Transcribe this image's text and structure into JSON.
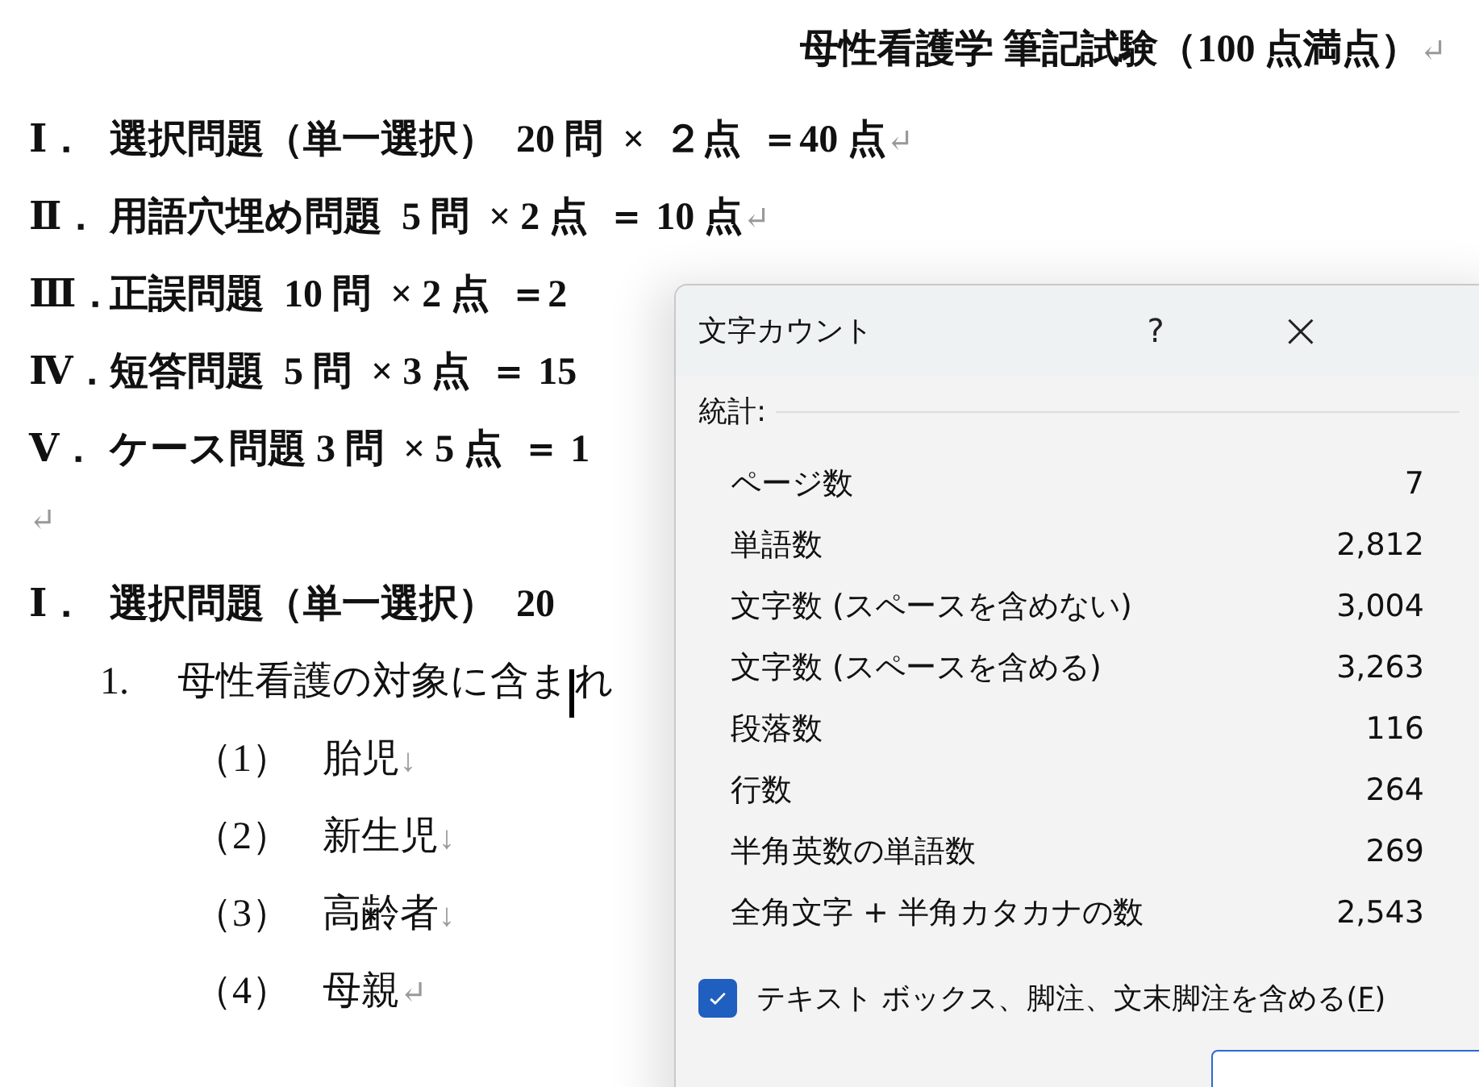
{
  "document": {
    "title": {
      "text": "母性看護学  筆記試験（100 点満点）",
      "mark": "↵"
    },
    "lines": [
      {
        "kind": "heading",
        "numeral": "Ⅰ．",
        "text": "選択問題（単一選択）  20 問  ×  ２点  ＝40 点",
        "mark": "↵"
      },
      {
        "kind": "heading",
        "numeral": "Ⅱ．",
        "text": "用語穴埋め問題  5 問  × 2 点  ＝ 10 点",
        "mark": "↵"
      },
      {
        "kind": "heading",
        "numeral": "Ⅲ．",
        "text": "正誤問題  10 問  × 2 点  ＝2"
      },
      {
        "kind": "heading",
        "numeral": "Ⅳ．",
        "text": "短答問題  5 問  × 3 点  ＝ 15"
      },
      {
        "kind": "heading",
        "numeral": "Ⅴ．",
        "text": "ケース問題 3 問  × 5 点  ＝ 1"
      },
      {
        "kind": "blank",
        "mark": "↵"
      },
      {
        "kind": "heading",
        "numeral": "Ⅰ．",
        "text": "選択問題（単一選択）  20"
      },
      {
        "kind": "question",
        "numeral": "1.",
        "text": "母性看護の対象に含ま",
        "text_after_cursor": "れ"
      },
      {
        "kind": "option",
        "numeral": "（1）",
        "text": "胎児",
        "mark": "↓"
      },
      {
        "kind": "option",
        "numeral": "（2）",
        "text": "新生児",
        "mark": "↓"
      },
      {
        "kind": "option",
        "numeral": "（3）",
        "text": "高齢者",
        "mark": "↓"
      },
      {
        "kind": "option",
        "numeral": "（4）",
        "text": "母親",
        "mark": "↵"
      }
    ]
  },
  "dialog": {
    "title": "文字カウント",
    "help": "?",
    "close": "×",
    "group": "統計:",
    "stats": [
      {
        "label": "ページ数",
        "value": "7"
      },
      {
        "label": "単語数",
        "value": "2,812"
      },
      {
        "label": "文字数 (スペースを含めない)",
        "value": "3,004"
      },
      {
        "label": "文字数 (スペースを含める)",
        "value": "3,263"
      },
      {
        "label": "段落数",
        "value": "116"
      },
      {
        "label": "行数",
        "value": "264"
      },
      {
        "label": "半角英数の単語数",
        "value": "269"
      },
      {
        "label": "全角文字 + 半角カタカナの数",
        "value": "2,543"
      }
    ],
    "checkbox": {
      "label_before": "テキスト ボックス、脚注、文末脚注を含める(",
      "access_key": "F",
      "label_after": ")",
      "checked": true
    }
  }
}
